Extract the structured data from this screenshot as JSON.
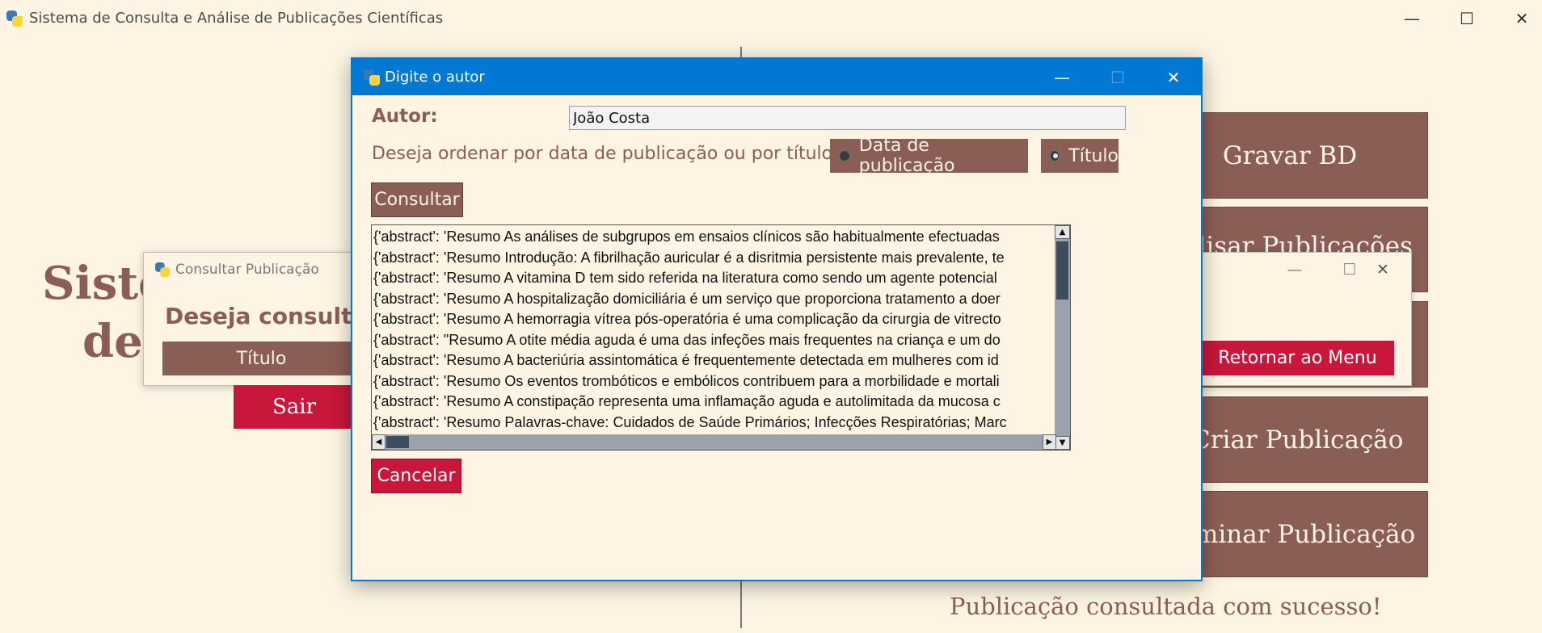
{
  "main_window": {
    "title": "Sistema de Consulta e Análise de Publicações Científicas",
    "controls": {
      "minimize": "—",
      "maximize": "☐",
      "close": "✕"
    }
  },
  "background": {
    "title_line1": "Siste",
    "title_line2": "de",
    "buttons": [
      "Gravar BD",
      "nalisar Publicações",
      "Criar Publicação",
      "minar Publicação"
    ],
    "sair_label": "Sair",
    "status_message": "Publicação consultada com sucesso!"
  },
  "consultar_window": {
    "title": "Consultar Publicação",
    "question": "Deseja consultar",
    "titulo_button": "Título",
    "retornar_button": "Retornar ao Menu",
    "controls": {
      "minimize": "—",
      "maximize": "☐",
      "close": "✕"
    }
  },
  "dialog": {
    "title": "Digite o autor",
    "controls": {
      "minimize": "—",
      "maximize": "☐",
      "close": "✕"
    },
    "autor_label": "Autor:",
    "autor_value": "João Costa",
    "ordenar_question": "Deseja ordenar por data de publicação ou por título?",
    "radio_options": [
      {
        "label": "Data de publicação",
        "selected": false
      },
      {
        "label": "Título",
        "selected": true
      }
    ],
    "consultar_label": "Consultar",
    "cancelar_label": "Cancelar",
    "results": [
      "{'abstract': 'Resumo As análises de subgrupos em ensaios clínicos são habitualmente efectuadas",
      "{'abstract': 'Resumo Introdução: A fibrilhação auricular é a disritmia persistente mais prevalente, te",
      "{'abstract': 'Resumo A vitamina D tem sido referida na literatura como sendo um agente potencial",
      "{'abstract': 'Resumo A hospitalização domiciliária é um serviço que proporciona tratamento a doer",
      "{'abstract': 'Resumo A hemorragia vítrea pós-operatória é uma complicação da cirurgia de vitrecto",
      "{'abstract': \"Resumo A otite média aguda é uma das infeções mais frequentes na criança e um do",
      "{'abstract': 'Resumo A bacteriúria assintomática é frequentemente detectada em mulheres com id",
      "{'abstract': 'Resumo Os eventos trombóticos e embólicos contribuem para a morbilidade e mortali",
      "{'abstract': 'Resumo A constipação representa uma inflamação aguda e autolimitada da mucosa c",
      "{'abstract': 'Resumo Palavras-chave: Cuidados de Saúde Primários; Infecções Respiratórias; Marc"
    ]
  },
  "colors": {
    "background": "#fdf4e3",
    "brown": "#8b5e55",
    "red": "#c8173a",
    "accent_blue": "#0078d4"
  }
}
